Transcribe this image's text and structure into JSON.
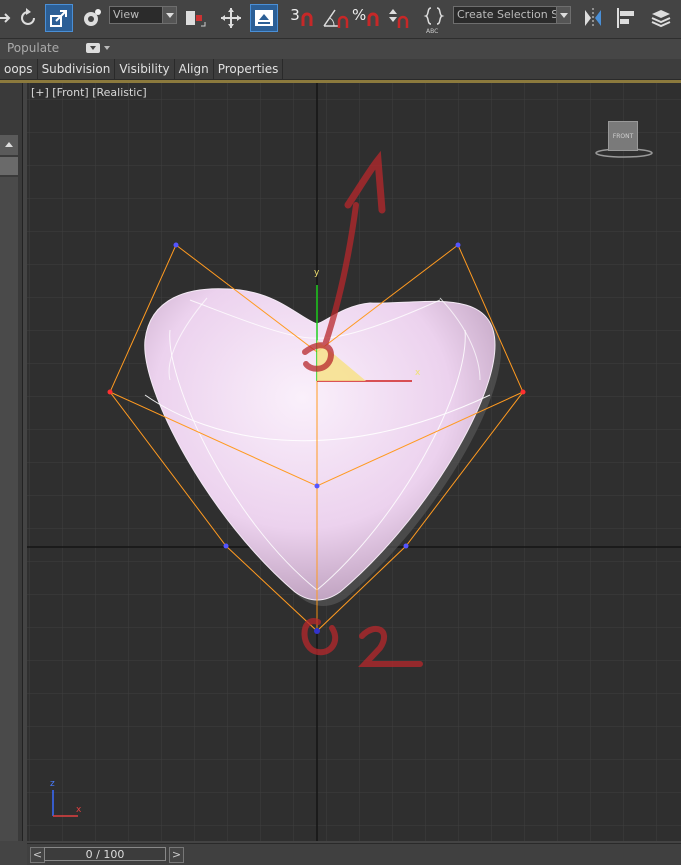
{
  "toolbar": {
    "view_dropdown": "View",
    "selection_set_dropdown": "Create Selection Se",
    "snap_3d_label": "3",
    "angle_snap_label": "∠",
    "percent_snap_label": "%",
    "abc_label": "ABC"
  },
  "ribbon": {
    "title": "Populate",
    "tabs": [
      "oops",
      "Subdivision",
      "Visibility",
      "Align",
      "Properties"
    ]
  },
  "viewport": {
    "label": "[+] [Front] [Realistic]",
    "viewcube_label": "FRONT",
    "gizmo_y_label": "y",
    "gizmo_x_label": "x",
    "axis_z_label": "z",
    "axis_x_label": "x",
    "annotation_1": "1",
    "annotation_2": "2"
  },
  "timeslider": {
    "frame_label": "0 / 100",
    "prev_glyph": "<",
    "next_glyph": ">"
  },
  "colors": {
    "accent_highlight": "#4a8fd6",
    "object_color": "#f3dff5",
    "cage_color": "#ff9a20",
    "annotation_color": "#c0282e"
  }
}
